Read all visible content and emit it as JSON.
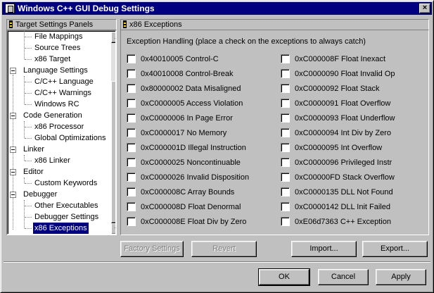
{
  "window": {
    "title": "Windows C++ GUI Debug Settings",
    "close_label": "×"
  },
  "tree": {
    "header": "Target Settings Panels",
    "items": [
      {
        "label": "File Mappings"
      },
      {
        "label": "Source Trees"
      },
      {
        "label": "x86 Target"
      },
      {
        "label": "Language Settings"
      },
      {
        "label": "C/C++ Language"
      },
      {
        "label": "C/C++ Warnings"
      },
      {
        "label": "Windows RC"
      },
      {
        "label": "Code Generation"
      },
      {
        "label": "x86 Processor"
      },
      {
        "label": "Global Optimizations"
      },
      {
        "label": "Linker"
      },
      {
        "label": "x86 Linker"
      },
      {
        "label": "Editor"
      },
      {
        "label": "Custom Keywords"
      },
      {
        "label": "Debugger"
      },
      {
        "label": "Other Executables"
      },
      {
        "label": "Debugger Settings"
      },
      {
        "label": "x86 Exceptions"
      }
    ],
    "selected": "x86 Exceptions"
  },
  "panel": {
    "header": "x86 Exceptions",
    "caption": "Exception Handling (place a check on the exceptions to always catch)",
    "left_exceptions": [
      "0x40010005 Control-C",
      "0x40010008 Control-Break",
      "0x80000002 Data Misaligned",
      "0xC0000005 Access Violation",
      "0xC0000006 In Page Error",
      "0xC0000017 No Memory",
      "0xC000001D Illegal Instruction",
      "0xC0000025 Noncontinuable",
      "0xC0000026 Invalid Disposition",
      "0xC000008C Array Bounds",
      "0xC000008D Float Denormal",
      "0xC000008E Float Div by Zero"
    ],
    "right_exceptions": [
      "0xC000008F Float Inexact",
      "0xC0000090 Float Invalid Op",
      "0xC0000092 Float Stack",
      "0xC0000091 Float Overflow",
      "0xC0000093 Float Underflow",
      "0xC0000094 Int Div by Zero",
      "0xC0000095 Int Overflow",
      "0xC0000096 Privileged Instr",
      "0xC00000FD Stack Overflow",
      "0xC0000135 DLL Not Found",
      "0xC0000142 DLL Init Failed",
      "0xE06d7363 C++ Exception"
    ]
  },
  "buttons": {
    "factory_settings": "Factory Settings",
    "revert": "Revert",
    "import": "Import...",
    "export": "Export...",
    "ok": "OK",
    "cancel": "Cancel",
    "apply": "Apply"
  }
}
